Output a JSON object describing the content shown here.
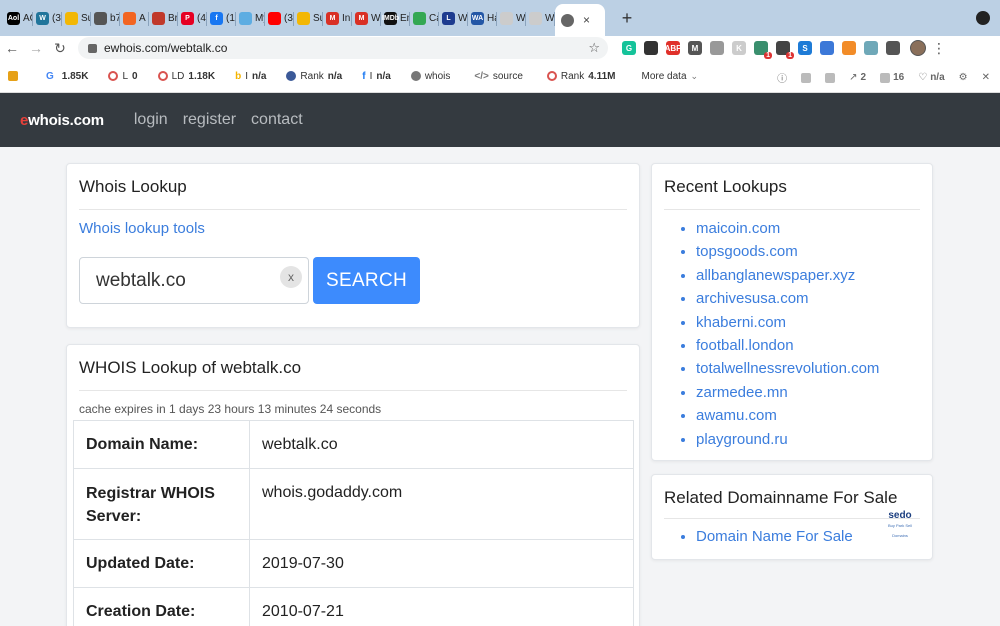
{
  "browser": {
    "tabs": [
      {
        "label": "AO",
        "favicon_text": "Aol",
        "color": "#000000"
      },
      {
        "label": "(35",
        "favicon_text": "W",
        "color": "#21759b"
      },
      {
        "label": "Sul",
        "favicon_text": "",
        "color": "#f2b705"
      },
      {
        "label": "b7",
        "favicon_text": "",
        "color": "#555555"
      },
      {
        "label": "A C",
        "favicon_text": "",
        "color": "#f26522"
      },
      {
        "label": "Brit",
        "favicon_text": "",
        "color": "#c0392b"
      },
      {
        "label": "(40",
        "favicon_text": "P",
        "color": "#e60023"
      },
      {
        "label": "(19",
        "favicon_text": "f",
        "color": "#1877f2"
      },
      {
        "label": "My",
        "favicon_text": "",
        "color": "#5dade2"
      },
      {
        "label": "(35",
        "favicon_text": "",
        "color": "#ff0000"
      },
      {
        "label": "Sul",
        "favicon_text": "",
        "color": "#f2b705"
      },
      {
        "label": "Inb",
        "favicon_text": "M",
        "color": "#d93025"
      },
      {
        "label": "We",
        "favicon_text": "M",
        "color": "#d93025"
      },
      {
        "label": "Ent",
        "favicon_text": "IMDb",
        "color": "#111111"
      },
      {
        "label": "Ca",
        "favicon_text": "",
        "color": "#34a853"
      },
      {
        "label": "We",
        "favicon_text": "L",
        "color": "#1d3b8f"
      },
      {
        "label": "Ha",
        "favicon_text": "WA",
        "color": "#2457a6"
      },
      {
        "label": "We",
        "favicon_text": "",
        "color": "#cccccc"
      },
      {
        "label": "We",
        "favicon_text": "",
        "color": "#cccccc"
      }
    ],
    "active_tab": {
      "close": "×"
    },
    "new_tab": "+",
    "url": "ewhois.com/webtalk.co",
    "extensions": [
      {
        "name": "grammarly-icon",
        "color": "#15c39a",
        "text": "G"
      },
      {
        "name": "ext-icon",
        "color": "#333333",
        "text": ""
      },
      {
        "name": "adblock-icon",
        "color": "#e0302a",
        "text": "ABP"
      },
      {
        "name": "ext-icon",
        "color": "#555555",
        "text": "M"
      },
      {
        "name": "ext-icon",
        "color": "#999999",
        "text": ""
      },
      {
        "name": "ext-icon",
        "color": "#cccccc",
        "text": "K"
      },
      {
        "name": "ext-icon",
        "color": "#3a8f6e",
        "text": "",
        "badge": "1"
      },
      {
        "name": "ext-icon",
        "color": "#444444",
        "text": "",
        "badge": "1"
      },
      {
        "name": "ext-icon",
        "color": "#1e7bd6",
        "text": "S"
      },
      {
        "name": "ext-icon",
        "color": "#3c78d8",
        "text": ""
      },
      {
        "name": "ext-icon",
        "color": "#f28c28",
        "text": ""
      },
      {
        "name": "ext-icon",
        "color": "#6fa8b8",
        "text": ""
      },
      {
        "name": "puzzle-icon",
        "color": "#555555",
        "text": ""
      }
    ]
  },
  "seo_toolbar": {
    "items": [
      {
        "label": "",
        "prefix": "G",
        "value": "1.85K"
      },
      {
        "label": "L",
        "prefix": "",
        "value": "0"
      },
      {
        "label": "LD",
        "prefix": "",
        "value": "1.18K"
      },
      {
        "label": "I",
        "prefix": "b",
        "value": "n/a"
      },
      {
        "label": "Rank",
        "prefix": "",
        "value": "n/a"
      },
      {
        "label": "I",
        "prefix": "f",
        "value": "n/a"
      },
      {
        "label": "whois",
        "prefix": "",
        "value": ""
      },
      {
        "label": "source",
        "prefix": "</>",
        "value": ""
      },
      {
        "label": "Rank",
        "prefix": "",
        "value": "4.11M"
      }
    ],
    "more_label": "More data",
    "right": {
      "links_count": "2",
      "pages_count": "16",
      "rating": "n/a"
    }
  },
  "site": {
    "brand_e": "e",
    "brand_rest": "whois.com",
    "nav": [
      "login",
      "register",
      "contact"
    ]
  },
  "lookup": {
    "title": "Whois Lookup",
    "tools_link": "Whois lookup tools",
    "query": "webtalk.co",
    "clear": "x",
    "search_button": "SEARCH"
  },
  "result": {
    "title": "WHOIS Lookup of webtalk.co",
    "cache_note": "cache expires in 1 days 23 hours 13 minutes 24 seconds",
    "rows": [
      {
        "key": "Domain Name:",
        "value": "webtalk.co"
      },
      {
        "key": "Registrar WHOIS Server:",
        "value": "whois.godaddy.com"
      },
      {
        "key": "Updated Date:",
        "value": "2019-07-30"
      },
      {
        "key": "Creation Date:",
        "value": "2010-07-21"
      }
    ]
  },
  "recent": {
    "title": "Recent Lookups",
    "items": [
      "maicoin.com",
      "topsgoods.com",
      "allbanglanewspaper.xyz",
      "archivesusa.com",
      "khaberni.com",
      "football.london",
      "totalwellnessrevolution.com",
      "zarmedee.mn",
      "awamu.com",
      "playground.ru"
    ]
  },
  "related": {
    "title": "Related Domainname For Sale",
    "logo_text": "sedo",
    "logo_tagline": "Buy Park Sell Domains",
    "items": [
      "Domain Name For Sale"
    ]
  }
}
